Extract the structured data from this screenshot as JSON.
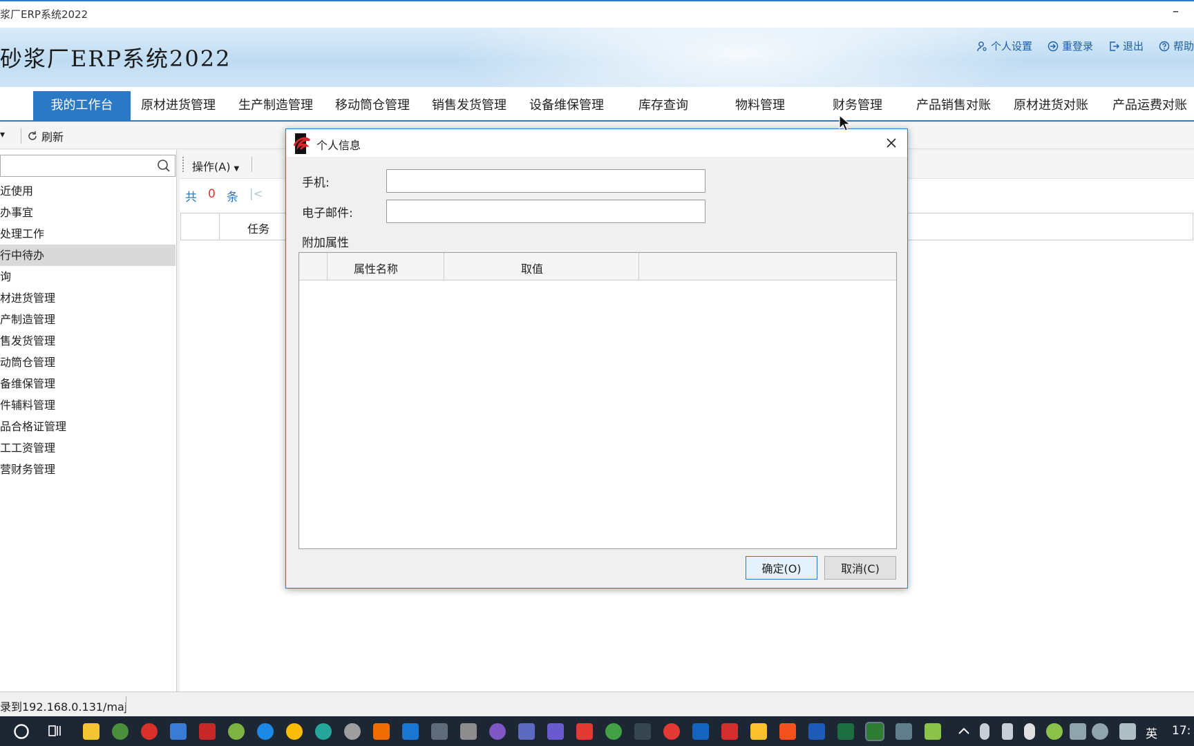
{
  "window": {
    "title": "浆厂ERP系统2022",
    "minimize": "–"
  },
  "banner": {
    "app_title": "砂浆厂ERP系统2022",
    "links": [
      {
        "label": "个人设置",
        "icon": "user-settings-icon"
      },
      {
        "label": "重登录",
        "icon": "relogin-icon"
      },
      {
        "label": "退出",
        "icon": "logout-icon"
      },
      {
        "label": "帮助",
        "icon": "help-icon"
      }
    ]
  },
  "menu": {
    "items": [
      "我的工作台",
      "原材进货管理",
      "生产制造管理",
      "移动筒仓管理",
      "销售发货管理",
      "设备维保管理",
      "库存查询",
      "物料管理",
      "财务管理",
      "产品销售对账",
      "原材进货对账",
      "产品运费对账"
    ],
    "active_index": 0
  },
  "toolbar": {
    "dropdown": "▾",
    "refresh_label": "刷新"
  },
  "sidebar": {
    "search_placeholder": "",
    "items": [
      "近使用",
      "办事宜",
      "处理工作",
      "行中待办",
      "询",
      "材进货管理",
      "产制造管理",
      "售发货管理",
      "动筒仓管理",
      "备维保管理",
      "件辅料管理",
      "品合格证管理",
      "工工资管理",
      "营财务管理"
    ],
    "selected_index": 3
  },
  "content": {
    "ops_label": "操作(A)",
    "pager": {
      "prefix": "共",
      "count": "0",
      "suffix": "条",
      "first": "|<",
      "prev": "<"
    },
    "grid": {
      "col_task": "任务"
    }
  },
  "status": {
    "text": "录到192.168.0.131/maj"
  },
  "taskbar": {
    "ime": "英",
    "clock": "17:"
  },
  "dialog": {
    "title": "个人信息",
    "phone_label": "手机:",
    "phone_value": "",
    "email_label": "电子邮件:",
    "email_value": "",
    "extra_label": "附加属性",
    "col_name": "属性名称",
    "col_value": "取值",
    "ok_label": "确定(O)",
    "cancel_label": "取消(C)"
  }
}
